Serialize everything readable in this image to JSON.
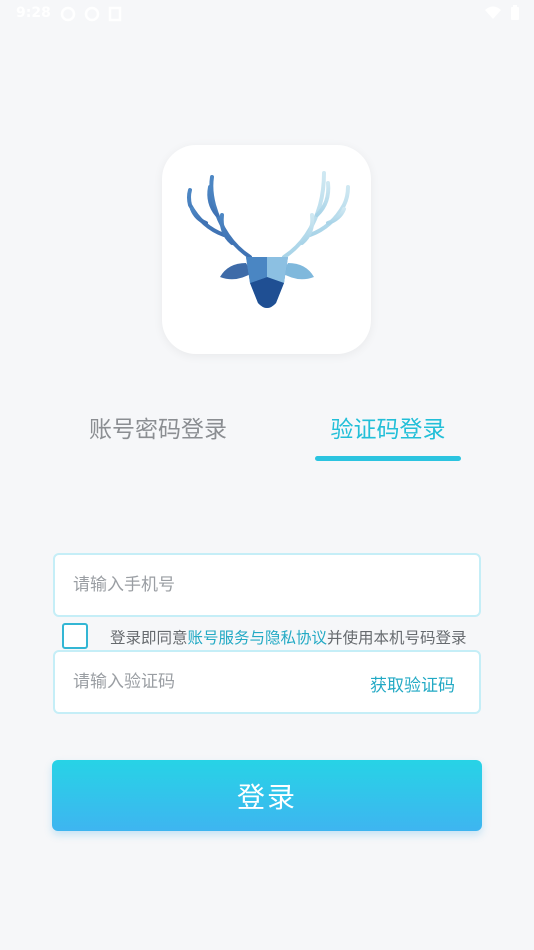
{
  "status_bar": {
    "time": "9:28",
    "left_icons": [
      "notification-icon",
      "notification-icon",
      "sim-icon"
    ],
    "right_icons": [
      "wifi-icon",
      "battery-icon"
    ]
  },
  "logo": {
    "icon": "deer-antler-logo-icon"
  },
  "tabs": {
    "password_label": "账号密码登录",
    "sms_label": "验证码登录",
    "active": "sms"
  },
  "phone_field": {
    "value": "",
    "placeholder": "请输入手机号"
  },
  "agreement": {
    "checked": false,
    "prefix": "登录即同意",
    "link": "账号服务与隐私协议",
    "suffix": "并使用本机号码登录"
  },
  "code_field": {
    "value": "",
    "placeholder": "请输入验证码",
    "get_code_label": "获取验证码"
  },
  "login_button": {
    "label": "登录"
  },
  "colors": {
    "accent": "#22bfd8",
    "link": "#22a9c4",
    "button_gradient_top": "#27d3e6",
    "button_gradient_bottom": "#3eb5f0",
    "field_border": "#c5eef7",
    "background": "#f6f7f9"
  }
}
